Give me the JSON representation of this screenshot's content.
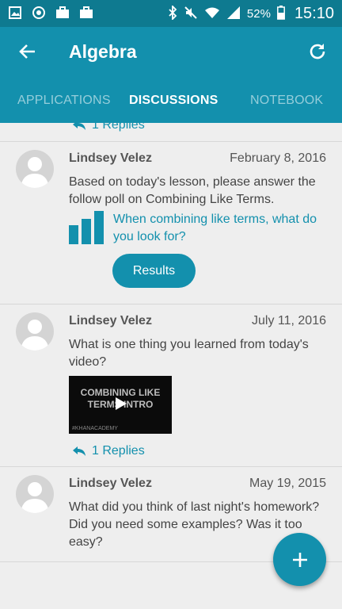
{
  "status_bar": {
    "battery_percent": "52%",
    "time": "15:10"
  },
  "app_bar": {
    "title": "Algebra",
    "back_icon": "arrow-left-icon",
    "refresh_icon": "refresh-icon"
  },
  "tabs": [
    {
      "label": "APPLICATIONS",
      "active": false
    },
    {
      "label": "DISCUSSIONS",
      "active": true
    },
    {
      "label": "NOTEBOOK",
      "active": false
    }
  ],
  "colors": {
    "status_bar": "#0e7a90",
    "app_bar": "#1390ad",
    "accent": "#1390ad",
    "background": "#eeeeee"
  },
  "partial_post": {
    "replies": "1 Replies"
  },
  "posts": [
    {
      "author": "Lindsey Velez",
      "date": "February 8, 2016",
      "text": "Based on today's lesson, please answer the follow poll on Combining Like Terms.",
      "poll_question": "When combining like terms, what do you look for?",
      "button_label": "Results"
    },
    {
      "author": "Lindsey Velez",
      "date": "July 11, 2016",
      "text": "What is one thing you learned from today's video?",
      "video_title": "COMBINING LIKE TERMS INTRO",
      "video_watermark": "#KHANACADEMY",
      "replies": "1 Replies"
    },
    {
      "author": "Lindsey Velez",
      "date": "May 19, 2015",
      "text": "What did you think of last night's homework?  Did you need some examples? Was it too easy?"
    }
  ],
  "fab": {
    "icon": "plus-icon"
  }
}
